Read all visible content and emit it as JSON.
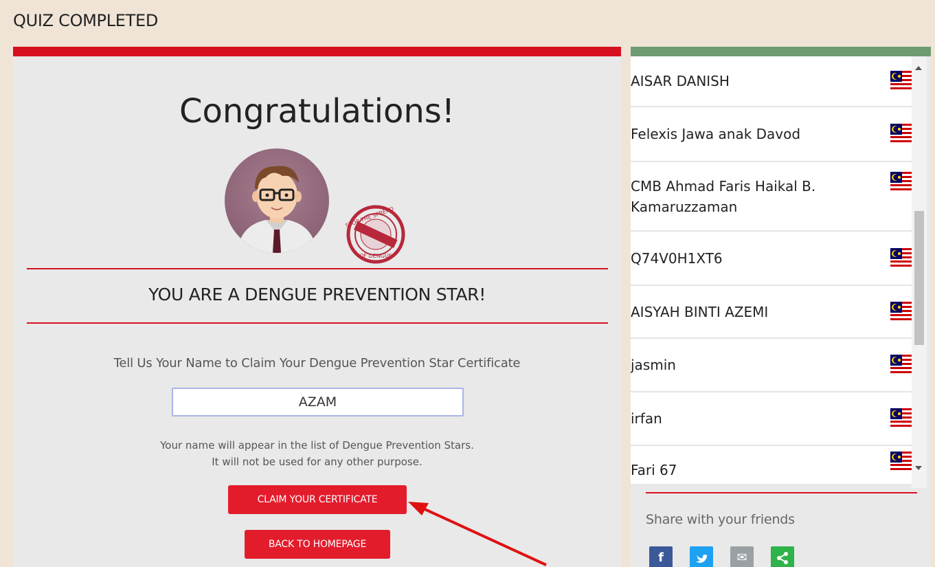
{
  "page": {
    "title": "QUIZ COMPLETED"
  },
  "result": {
    "heading": "Congratulations!",
    "star_title": "YOU ARE A DENGUE PREVENTION STAR!",
    "stamp_text": "STOP THE SPREAD OF DENGUE",
    "prompt": "Tell Us Your Name to Claim Your Dengue Prevention Star Certificate",
    "name_value": "AZAM",
    "note_line1": "Your name will appear in the list of Dengue Prevention Stars.",
    "note_line2": "It will not be used for any other purpose.",
    "claim_button": "CLAIM YOUR CERTIFICATE",
    "home_button": "BACK TO HOMEPAGE"
  },
  "stars_list": [
    {
      "name": "AISAR DANISH",
      "flag": "malaysia-flag-icon"
    },
    {
      "name": "Felexis Jawa anak Davod",
      "flag": "malaysia-flag-icon"
    },
    {
      "name": "CMB Ahmad Faris Haikal B. Kamaruzzaman",
      "flag": "malaysia-flag-icon"
    },
    {
      "name": "Q74V0H1XT6",
      "flag": "malaysia-flag-icon"
    },
    {
      "name": "AISYAH BINTI AZEMI",
      "flag": "malaysia-flag-icon"
    },
    {
      "name": "jasmin",
      "flag": "malaysia-flag-icon"
    },
    {
      "name": "irfan",
      "flag": "malaysia-flag-icon"
    },
    {
      "name": "Fari 67",
      "flag": "malaysia-flag-icon"
    }
  ],
  "share": {
    "label": "Share with your friends",
    "buttons": [
      {
        "icon": "facebook-icon",
        "glyph": "f"
      },
      {
        "icon": "twitter-icon",
        "glyph": "t"
      },
      {
        "icon": "email-icon",
        "glyph": "✉"
      },
      {
        "icon": "share-icon",
        "glyph": "<"
      }
    ]
  },
  "colors": {
    "accent_red": "#d7101f",
    "button_red": "#e31c2c",
    "panel_green": "#6f9b72",
    "page_bg": "#f0e4d6"
  }
}
